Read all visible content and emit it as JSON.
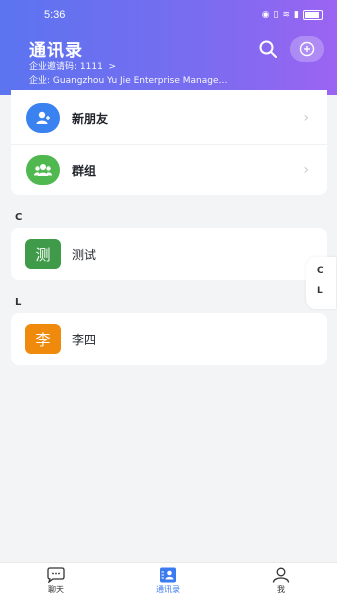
{
  "status_bar": {
    "time": "5:36"
  },
  "header": {
    "title": "通讯录",
    "invite_label": "企业邀请码: 1111",
    "invite_chevron": ">",
    "company": "企业: Guangzhou Yu Jie Enterprise Management Co., Ltd."
  },
  "top_items": [
    {
      "label": "新朋友",
      "icon": "add-friend-icon",
      "color": "#3a82f0"
    },
    {
      "label": "群组",
      "icon": "group-icon",
      "color": "#4fb84f"
    }
  ],
  "sections": [
    {
      "letter": "C",
      "contacts": [
        {
          "avatar_text": "测",
          "name": "测试",
          "color": "#3f9b4a"
        }
      ]
    },
    {
      "letter": "L",
      "contacts": [
        {
          "avatar_text": "李",
          "name": "李四",
          "color": "#f08a0c"
        }
      ]
    }
  ],
  "index_bar": [
    "C",
    "L"
  ],
  "tabbar": {
    "tabs": [
      {
        "label": "聊天",
        "icon": "chat-icon",
        "active": false
      },
      {
        "label": "通讯录",
        "icon": "contacts-icon",
        "active": true
      },
      {
        "label": "我",
        "icon": "profile-icon",
        "active": false
      }
    ]
  },
  "colors": {
    "header_gradient_start": "#5b74f0",
    "header_gradient_end": "#9b64f2",
    "accent": "#3a7bf0"
  }
}
